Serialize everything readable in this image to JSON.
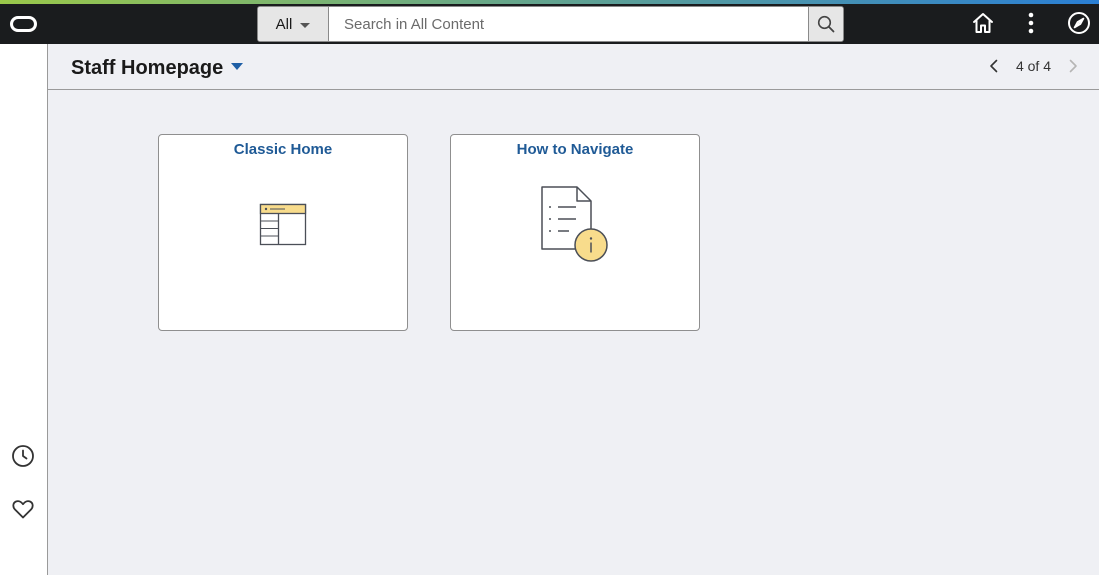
{
  "header": {
    "search": {
      "scope_label": "All",
      "placeholder": "Search in All Content",
      "value": ""
    },
    "icons": [
      "oracle-logo",
      "home-icon",
      "actions-menu-icon",
      "navigator-compass-icon",
      "search-icon"
    ]
  },
  "sidebar": {
    "icons": [
      "recent-history-clock-icon",
      "favorites-heart-icon"
    ]
  },
  "page": {
    "title": "Staff Homepage",
    "pager": {
      "label": "4 of 4"
    }
  },
  "tiles": [
    {
      "title": "Classic Home",
      "icon": "classic-home-icon"
    },
    {
      "title": "How to Navigate",
      "icon": "document-info-icon"
    }
  ],
  "colors": {
    "topbar_bg": "#1a1c1e",
    "accent_gradient_start": "#9ac84a",
    "accent_gradient_end": "#2a7fd5",
    "main_bg": "#eff0f4",
    "tile_title": "#1f5a96",
    "icon_yellow": "#f8dc8c"
  }
}
